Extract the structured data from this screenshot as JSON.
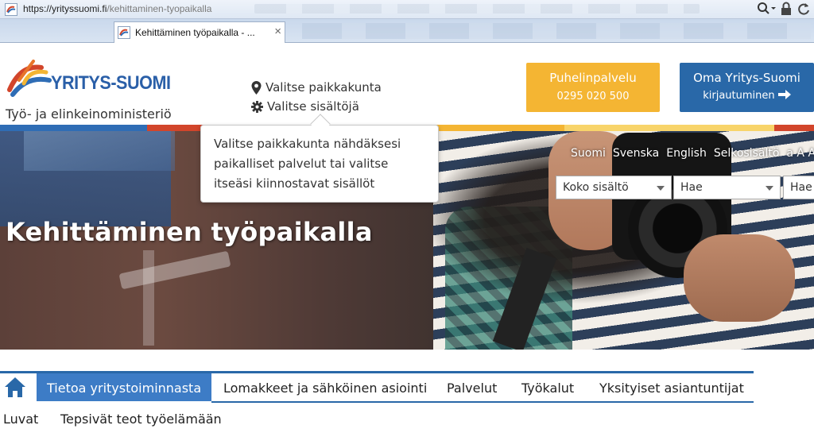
{
  "browser": {
    "url_host": "https://yrityssuomi.fi",
    "url_path": "/kehittaminen-tyopaikalla",
    "tab_title": "Kehittäminen työpaikalla - ...",
    "tab_close": "×"
  },
  "header": {
    "logo_text": "YRITYS-SUOMI",
    "ministry": "Työ- ja elinkeinoministeriö",
    "choose_location": "Valitse paikkakunta",
    "choose_content": "Valitse sisältöjä",
    "phone_button": {
      "title": "Puhelinpalvelu",
      "number": "0295 020 500"
    },
    "account_button": {
      "title": "Oma Yritys-Suomi",
      "subtitle": "kirjautuminen"
    }
  },
  "stripe_colors": [
    "#2f6db5",
    "#d2452b",
    "#e8742a",
    "#f4b533",
    "#f8d46a",
    "#e9a02f",
    "#d2452b"
  ],
  "tooltip": {
    "line1": "Valitse paikkakunta nähdäksesi",
    "line2": "paikalliset palvelut tai valitse",
    "line3": "itseäsi kiinnostavat sisällöt"
  },
  "hero": {
    "title": "Kehittäminen työpaikalla",
    "languages": [
      "Suomi",
      "Svenska",
      "English",
      "Selkosisältö",
      "a A A+"
    ],
    "search_scope": "Koko sisältö",
    "search_placeholder": "Hae",
    "search_button": "Hae"
  },
  "nav": {
    "active": "Tietoa yritystoiminnasta",
    "items": [
      "Lomakkeet ja sähköinen asiointi",
      "Palvelut",
      "Työkalut",
      "Yksityiset asiantuntijat"
    ],
    "row2": [
      "Luvat",
      "Tepsivät teot työelämään"
    ]
  },
  "icons": {
    "home": "home-icon",
    "location": "map-pin-icon",
    "settings": "gear-icon",
    "arrow": "arrow-right-icon",
    "search": "search-icon",
    "lock": "lock-icon",
    "refresh": "refresh-icon"
  },
  "colors": {
    "brand_blue": "#2968a8",
    "nav_active": "#3d7cc6",
    "phone_yellow": "#f4b533"
  }
}
